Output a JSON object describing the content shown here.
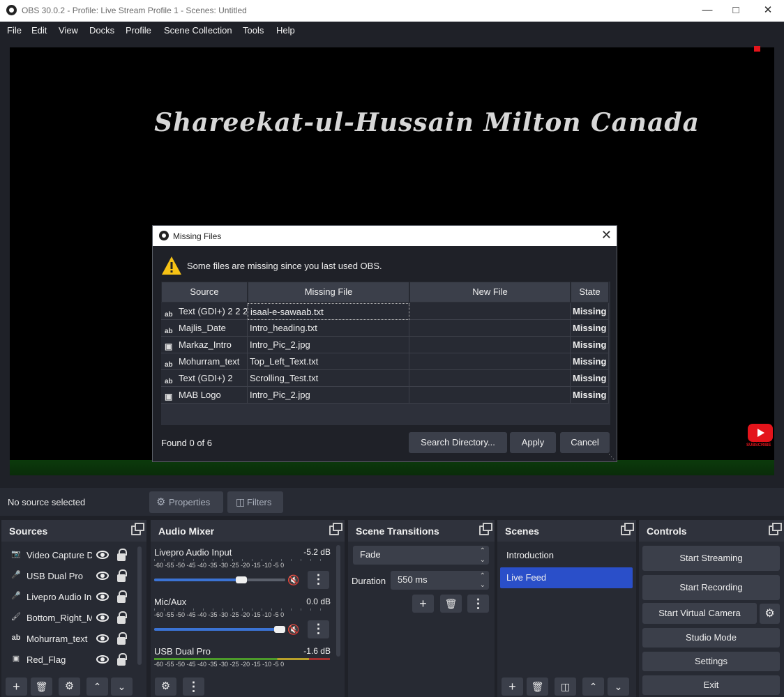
{
  "window": {
    "title": "OBS 30.0.2 - Profile: Live Stream Profile 1 - Scenes: Untitled"
  },
  "menu": [
    "File",
    "Edit",
    "View",
    "Docks",
    "Profile",
    "Scene Collection",
    "Tools",
    "Help"
  ],
  "preview": {
    "overlay_title": "Shareekat-ul-Hussain Milton Canada",
    "yt_label": "SUBSCRIBE"
  },
  "source_toolbar": {
    "status": "No source selected",
    "properties": "Properties",
    "filters": "Filters"
  },
  "dialog": {
    "title": "Missing Files",
    "message": "Some files are missing since you last used OBS.",
    "columns": [
      "Source",
      "Missing File",
      "New File",
      "State"
    ],
    "rows": [
      {
        "icon": "text",
        "source": "Text (GDI+) 2 2 2",
        "missing": "isaal-e-sawaab.txt",
        "new": "",
        "state": "Missing"
      },
      {
        "icon": "text",
        "source": "Majlis_Date",
        "missing": "Intro_heading.txt",
        "new": "",
        "state": "Missing"
      },
      {
        "icon": "image",
        "source": "Markaz_Intro",
        "missing": "Intro_Pic_2.jpg",
        "new": "",
        "state": "Missing"
      },
      {
        "icon": "text",
        "source": "Mohurram_text",
        "missing": "Top_Left_Text.txt",
        "new": "",
        "state": "Missing"
      },
      {
        "icon": "text",
        "source": "Text (GDI+) 2",
        "missing": "Scrolling_Test.txt",
        "new": "",
        "state": "Missing"
      },
      {
        "icon": "image",
        "source": "MAB Logo",
        "missing": "Intro_Pic_2.jpg",
        "new": "",
        "state": "Missing"
      }
    ],
    "found": "Found 0 of 6",
    "buttons": {
      "search": "Search Directory...",
      "apply": "Apply",
      "cancel": "Cancel"
    }
  },
  "sources": {
    "title": "Sources",
    "items": [
      {
        "icon": "camera",
        "label": "Video Capture D"
      },
      {
        "icon": "mic",
        "label": "USB Dual Pro"
      },
      {
        "icon": "mic",
        "label": "Livepro Audio In"
      },
      {
        "icon": "brush",
        "label": "Bottom_Right_M"
      },
      {
        "icon": "text",
        "label": "Mohurram_text"
      },
      {
        "icon": "image",
        "label": "Red_Flag"
      }
    ]
  },
  "audio_mixer": {
    "title": "Audio Mixer",
    "scale": "-60 -55 -50 -45 -40 -35 -30 -25 -20 -15 -10  -5   0",
    "channels": [
      {
        "name": "Livepro Audio Input",
        "db": "-5.2 dB",
        "volume": 0.71
      },
      {
        "name": "Mic/Aux",
        "db": "0.0 dB",
        "volume": 1.0
      },
      {
        "name": "USB Dual Pro",
        "db": "-1.6 dB",
        "volume": 0.9
      }
    ]
  },
  "scene_transitions": {
    "title": "Scene Transitions",
    "transition": "Fade",
    "duration_label": "Duration",
    "duration": "550 ms"
  },
  "scenes": {
    "title": "Scenes",
    "items": [
      "Introduction",
      "Live Feed"
    ],
    "selected": 1
  },
  "controls": {
    "title": "Controls",
    "start_streaming": "Start Streaming",
    "start_recording": "Start Recording",
    "start_virtual_camera": "Start Virtual Camera",
    "studio_mode": "Studio Mode",
    "settings": "Settings",
    "exit": "Exit"
  },
  "colors": {
    "accent": "#2a4fc9",
    "background": "#1f2128",
    "dock": "#272a33",
    "button": "#3b3f4a",
    "mute": "#d41616"
  }
}
